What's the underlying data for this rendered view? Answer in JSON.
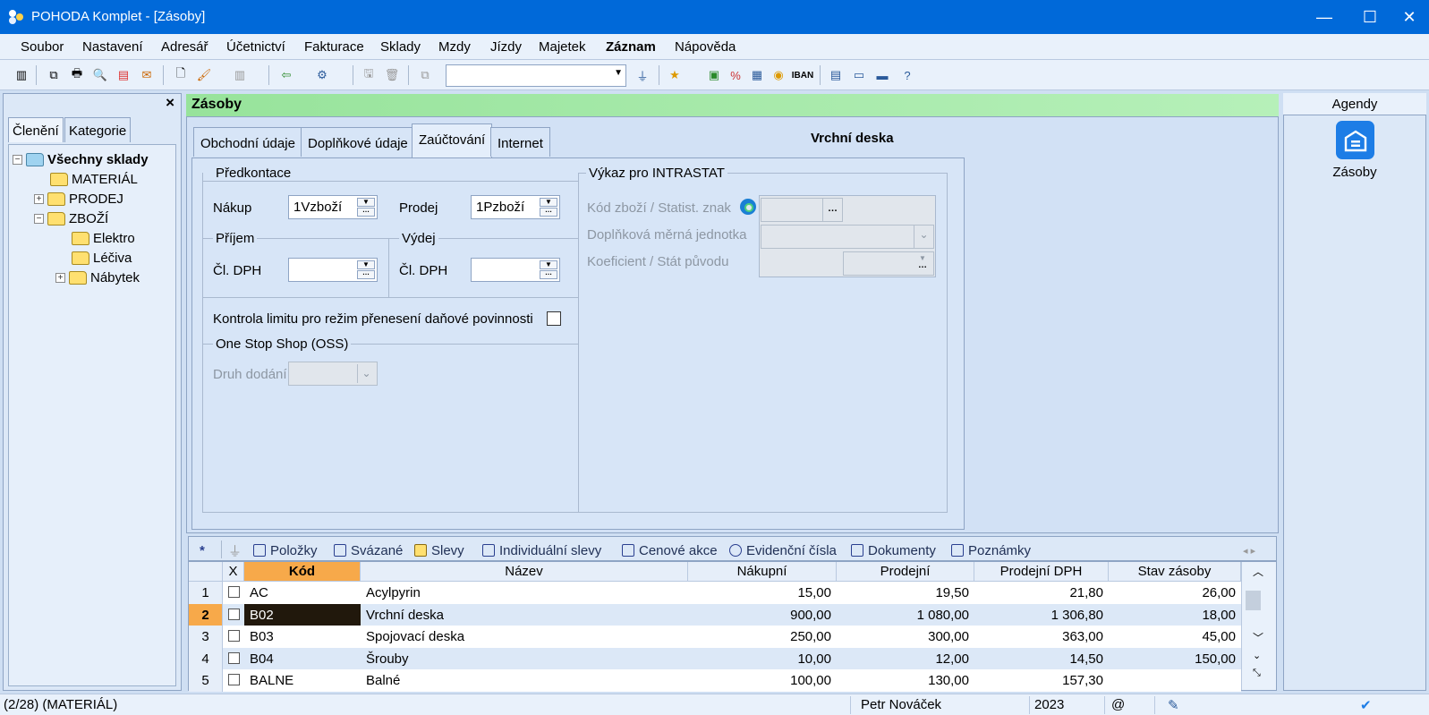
{
  "window": {
    "title": "POHODA Komplet - [Zásoby]",
    "minimize": "—",
    "maximize": "☐",
    "close": "✕"
  },
  "menu": [
    "Soubor",
    "Nastavení",
    "Adresář",
    "Účetnictví",
    "Fakturace",
    "Sklady",
    "Mzdy",
    "Jízdy",
    "Majetek",
    "Záznam",
    "Nápověda"
  ],
  "toolbar": {
    "search_value": ""
  },
  "left_panel": {
    "close": "×",
    "tabs": [
      "Členění",
      "Kategorie"
    ],
    "tree": {
      "root": "Všechny sklady",
      "material": "MATERIÁL",
      "prodej": "PRODEJ",
      "zbozi": "ZBOŽÍ",
      "elektro": "Elektro",
      "leciva": "Léčiva",
      "nabytek": "Nábytek"
    }
  },
  "main": {
    "header": "Zásoby",
    "record_title": "Vrchní deska",
    "tabs": [
      "Obchodní údaje",
      "Doplňkové údaje",
      "Zaúčtování",
      "Internet"
    ],
    "active_tab": "Zaúčtování",
    "predkontace": {
      "group": "Předkontace",
      "nakup_label": "Nákup",
      "nakup_value": "1Vzboží",
      "prodej_label": "Prodej",
      "prodej_value": "1Pzboží"
    },
    "prijem": {
      "group": "Příjem",
      "dph_label": "Čl. DPH",
      "dph_value": ""
    },
    "vydej": {
      "group": "Výdej",
      "dph_label": "Čl. DPH",
      "dph_value": ""
    },
    "kontrola_label": "Kontrola limitu pro režim přenesení daňové povinnosti",
    "oss": {
      "group": "One Stop Shop (OSS)",
      "druh_label": "Druh dodání"
    },
    "intrastat": {
      "group": "Výkaz pro INTRASTAT",
      "kod_label": "Kód zboží / Statist. znak",
      "jednotka_label": "Doplňková měrná jednotka",
      "koef_label": "Koeficient / Stát původu"
    }
  },
  "right_panel": {
    "tab": "Agendy",
    "item": "Zásoby"
  },
  "bottom_tabs": [
    "*",
    "Položky",
    "Svázané",
    "Slevy",
    "Individuální slevy",
    "Cenové akce",
    "Evidenční čísla",
    "Dokumenty",
    "Poznámky"
  ],
  "grid": {
    "headers": [
      "X",
      "Kód",
      "Název",
      "Nákupní",
      "Prodejní",
      "Prodejní DPH",
      "Stav zásoby"
    ],
    "rows": [
      {
        "n": "1",
        "kod": "AC",
        "nazev": "Acylpyrin",
        "nakup": "15,00",
        "prodej": "19,50",
        "dph": "21,80",
        "stav": "26,00"
      },
      {
        "n": "2",
        "kod": "B02",
        "nazev": "Vrchní deska",
        "nakup": "900,00",
        "prodej": "1 080,00",
        "dph": "1 306,80",
        "stav": "18,00"
      },
      {
        "n": "3",
        "kod": "B03",
        "nazev": "Spojovací deska",
        "nakup": "250,00",
        "prodej": "300,00",
        "dph": "363,00",
        "stav": "45,00"
      },
      {
        "n": "4",
        "kod": "B04",
        "nazev": "Šrouby",
        "nakup": "10,00",
        "prodej": "12,00",
        "dph": "14,50",
        "stav": "150,00"
      },
      {
        "n": "5",
        "kod": "BALNE",
        "nazev": "Balné",
        "nakup": "100,00",
        "prodej": "130,00",
        "dph": "157,30",
        "stav": ""
      }
    ]
  },
  "status": {
    "record": "(2/28) (MATERIÁL)",
    "user": "Petr Nováček",
    "year": "2023",
    "at": "@"
  }
}
